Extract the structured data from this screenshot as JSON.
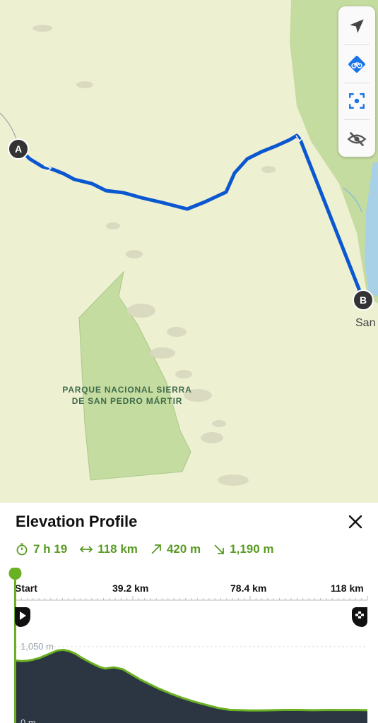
{
  "map": {
    "park_label_line1": "PARQUE NACIONAL SIERRA",
    "park_label_line2": "DE SAN PEDRO MÁRTIR",
    "marker_start": "A",
    "marker_end": "B",
    "town_label": "San",
    "route_color": "#0b57d0",
    "park_color": "#c5dca0"
  },
  "controls": [
    {
      "name": "navigate-icon"
    },
    {
      "name": "bike-layer-icon"
    },
    {
      "name": "recenter-icon"
    },
    {
      "name": "hide-icon"
    }
  ],
  "sheet": {
    "title": "Elevation Profile",
    "stats": {
      "duration": "7 h 19",
      "distance": "118 km",
      "ascent": "420 m",
      "descent": "1,190 m"
    },
    "axis": {
      "start": "Start",
      "tick1": "39.2 km",
      "tick2": "78.4 km",
      "end": "118 km"
    },
    "y_max_label": "1,050 m",
    "y_min_label": "0 m",
    "accent_color": "#6ab023"
  },
  "chart_data": {
    "type": "area",
    "x": [
      0,
      2,
      4,
      6,
      8,
      10,
      12,
      14,
      16,
      18,
      20,
      22,
      25,
      28,
      30,
      33,
      36,
      39.2,
      42,
      45,
      48,
      52,
      56,
      60,
      64,
      68,
      72,
      76,
      78.4,
      82,
      86,
      90,
      95,
      100,
      105,
      110,
      114,
      118
    ],
    "y": [
      830,
      820,
      825,
      845,
      870,
      910,
      950,
      990,
      1000,
      980,
      940,
      880,
      800,
      730,
      700,
      720,
      690,
      600,
      520,
      450,
      380,
      300,
      230,
      170,
      120,
      70,
      40,
      35,
      30,
      30,
      35,
      40,
      40,
      35,
      40,
      38,
      40,
      35
    ],
    "xlim": [
      0,
      118
    ],
    "ylim": [
      0,
      1050
    ],
    "x_ticks": [
      "Start",
      "39.2 km",
      "78.4 km",
      "118 km"
    ],
    "y_ticks": [
      "0 m",
      "1,050 m"
    ]
  }
}
